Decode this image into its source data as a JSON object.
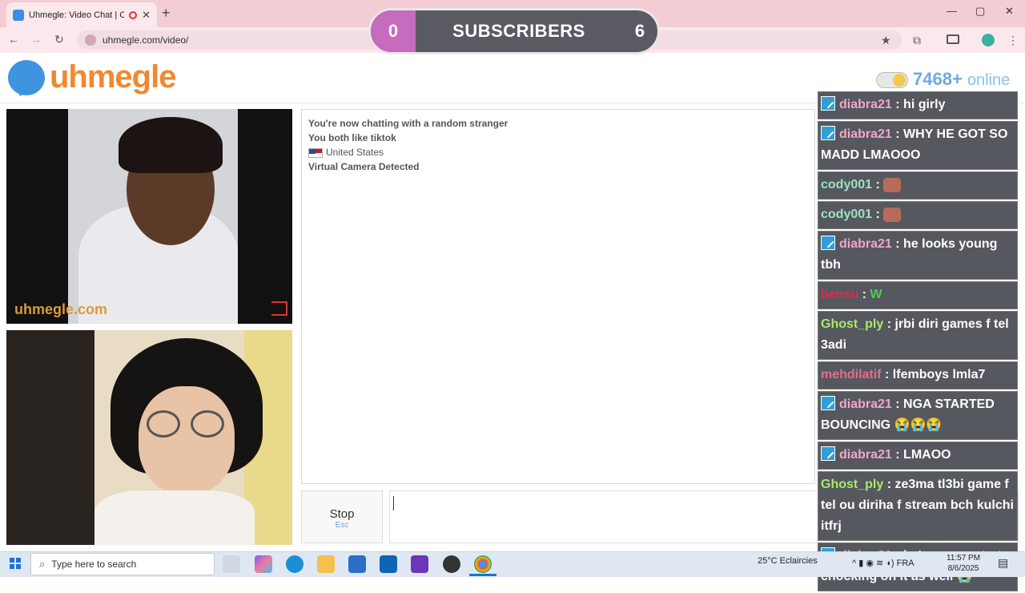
{
  "browser": {
    "tab_title": "Uhmegle: Video Chat | Ome",
    "url": "uhmegle.com/video/",
    "new_tab": "+",
    "tab_close": "✕",
    "win_min": "—",
    "win_max": "▢",
    "win_close": "✕",
    "back": "←",
    "forward": "→",
    "reload": "↻",
    "star": "★",
    "extensions": "⧉",
    "menu": "⋮"
  },
  "overlay_subs": {
    "left_count": "0",
    "label": "SUBSCRIBERS",
    "right_count": "6"
  },
  "site": {
    "logo_text": "uhmegle",
    "online_count": "7468+",
    "online_label": "online"
  },
  "video1": {
    "watermark": "uhmegle.com"
  },
  "chatlog": {
    "line1": "You're now chatting with a random stranger",
    "line2": "You both like tiktok",
    "country": "United States",
    "line4": "Virtual Camera Detected"
  },
  "controls": {
    "stop_label": "Stop",
    "stop_hint": "Esc"
  },
  "stream_chat": [
    {
      "user": "diabra21",
      "text": ": hi girly",
      "badge": true,
      "color": "pink"
    },
    {
      "user": "diabra21",
      "text": ": WHY HE GOT SO MADD LMAOOO",
      "badge": true,
      "color": "pink"
    },
    {
      "user": "cody001",
      "text": ":",
      "badge": false,
      "color": "teal",
      "emote": true
    },
    {
      "user": "cody001",
      "text": ":",
      "badge": false,
      "color": "teal",
      "emote": true
    },
    {
      "user": "diabra21",
      "text": ": he looks young tbh",
      "badge": true,
      "color": "pink"
    },
    {
      "user": "bensu",
      "text": ":",
      "badge": false,
      "color": "red",
      "wemote": "W"
    },
    {
      "user": "Ghost_ply",
      "text": ": jrbi diri games f tel 3adi",
      "badge": false,
      "color": "green"
    },
    {
      "user": "mehdilatif",
      "text": ": lfemboys lmla7",
      "badge": false,
      "color": "rose"
    },
    {
      "user": "diabra21",
      "text": ": NGA STARTED BOUNCING 😭😭😭",
      "badge": true,
      "color": "pink"
    },
    {
      "user": "diabra21",
      "text": ": LMAOO",
      "badge": true,
      "color": "pink"
    },
    {
      "user": "Ghost_ply",
      "text": ": ze3ma tl3bi game f tel ou diriha f stream bch kulchi itfrj",
      "badge": false,
      "color": "green"
    },
    {
      "user": "diabra21",
      "text": ": he's gonna start chocking on it as well 😭",
      "badge": true,
      "color": "pink"
    }
  ],
  "taskbar": {
    "search_placeholder": "Type here to search",
    "search_icon": "⌕",
    "weather_temp": "25°C",
    "weather_desc": "Eclaircies",
    "tray_text": "^ ▮ ◉ ≋ ◖)  FRA",
    "time": "11:57 PM",
    "date": "8/6/2025",
    "notif_icon": "▤"
  }
}
